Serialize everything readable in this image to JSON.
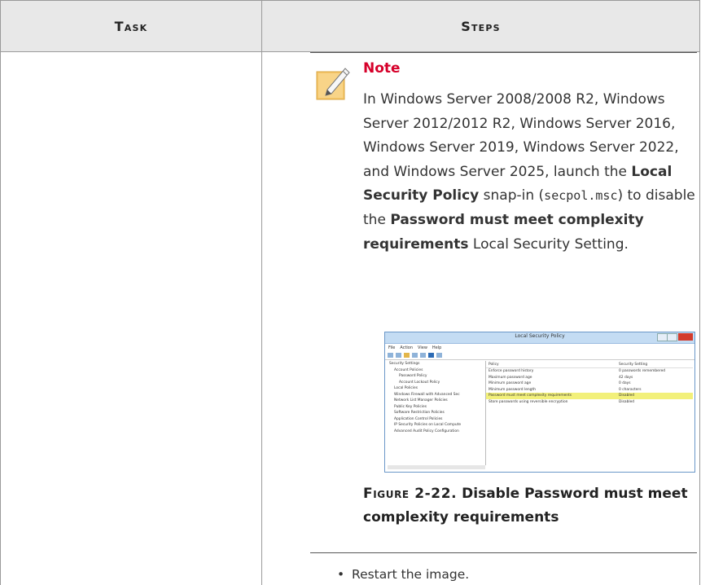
{
  "table": {
    "header": {
      "task": "Task",
      "steps": "Steps"
    }
  },
  "note": {
    "icon": "note-icon",
    "title": "Note",
    "body": {
      "intro": "In Windows Server 2008/2008 R2, Windows Server 2012/2012 R2, Windows Server 2016, Windows Server 2019, Windows Server 2022, and Windows Server 2025, launch the ",
      "snapin_name": "Local Security Policy",
      "snapin_text": " snap-in (",
      "command": "secpol.msc",
      "disable_text": ") to disable the ",
      "setting_name": "Password must meet complexity requirements",
      "outro": " Local Security Setting."
    }
  },
  "screenshot": {
    "window_title": "Local Security Policy",
    "menu": [
      "File",
      "Action",
      "View",
      "Help"
    ],
    "tree": [
      "Security Settings",
      "Account Policies",
      "Password Policy",
      "Account Lockout Policy",
      "Local Policies",
      "Windows Firewall with Advanced Sec",
      "Network List Manager Policies",
      "Public Key Policies",
      "Software Restriction Policies",
      "Application Control Policies",
      "IP Security Policies on Local Compute",
      "Advanced Audit Policy Configuration"
    ],
    "columns": {
      "policy": "Policy",
      "setting": "Security Setting"
    },
    "rows": [
      {
        "policy": "Enforce password history",
        "setting": "0 passwords remembered"
      },
      {
        "policy": "Maximum password age",
        "setting": "42 days"
      },
      {
        "policy": "Minimum password age",
        "setting": "0 days"
      },
      {
        "policy": "Minimum password length",
        "setting": "0 characters"
      },
      {
        "policy": "Password must meet complexity requirements",
        "setting": "Disabled"
      },
      {
        "policy": "Store passwords using reversible encryption",
        "setting": "Disabled"
      }
    ],
    "highlight_color": "#f2f07a"
  },
  "caption": {
    "label": "Figure 2-22.",
    "text": " Disable Password must meet complexity requirements"
  },
  "bullet": {
    "text": "Restart the image."
  }
}
